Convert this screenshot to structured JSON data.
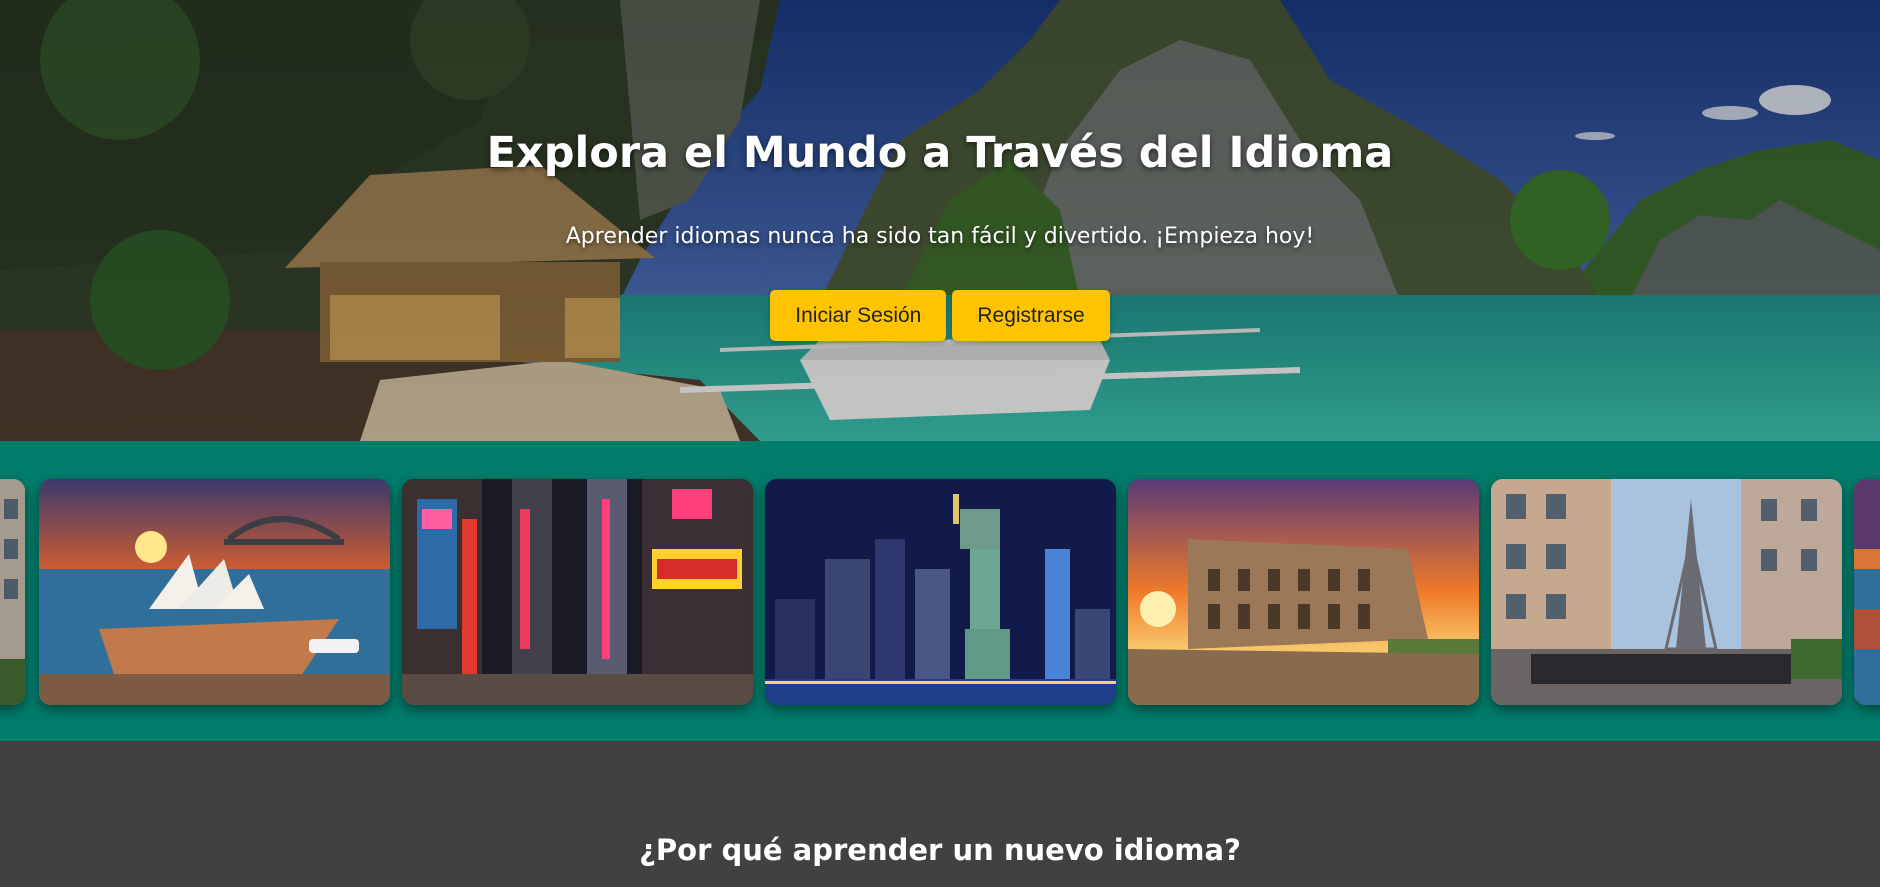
{
  "hero": {
    "title": "Explora el Mundo a Través del Idioma",
    "subtitle": "Aprender idiomas nunca ha sido tan fácil y divertido. ¡Empieza hoy!",
    "login_label": "Iniciar Sesión",
    "register_label": "Registrarse",
    "background_scene": "tropical-lagoon-hut-boat"
  },
  "carousel": {
    "background_color": "#007c6b",
    "cards": [
      {
        "scene": "paris-street-partial"
      },
      {
        "scene": "sydney-opera-house-sunset"
      },
      {
        "scene": "tokyo-neon-street"
      },
      {
        "scene": "new-york-statue-of-liberty-night"
      },
      {
        "scene": "rome-colosseum-sunset"
      },
      {
        "scene": "paris-eiffel-tower-street"
      },
      {
        "scene": "sydney-partial"
      }
    ]
  },
  "why": {
    "title": "¿Por qué aprender un nuevo idioma?"
  },
  "colors": {
    "accent_button": "#ffc400",
    "section_dark": "#434040",
    "carousel_teal": "#007c6b"
  }
}
